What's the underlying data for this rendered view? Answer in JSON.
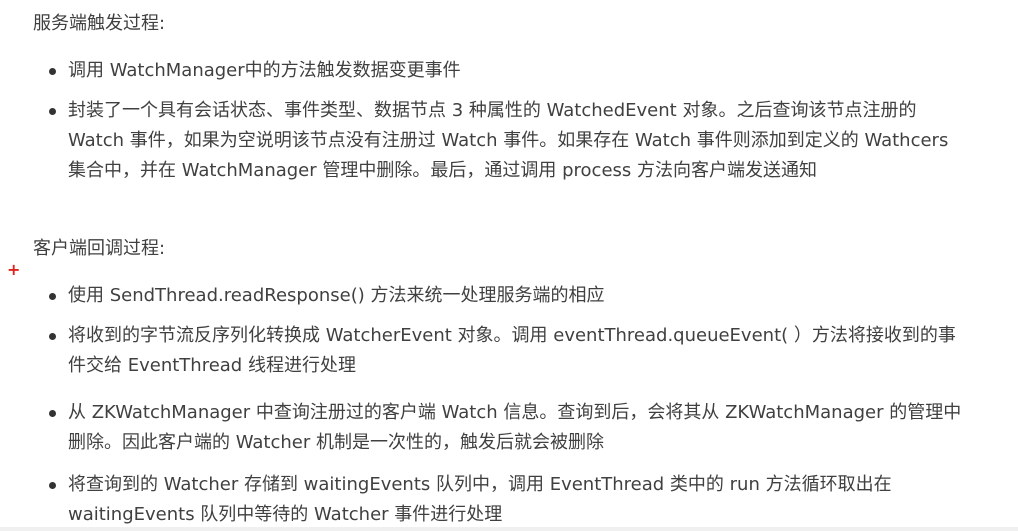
{
  "section1": {
    "heading": "服务端触发过程:",
    "items": [
      {
        "lines": [
          "调用 WatchManager中的方法触发数据变更事件"
        ]
      },
      {
        "lines": [
          "封装了一个具有会话状态、事件类型、数据节点 3 种属性的 WatchedEvent 对象。之后查询该节点注册的",
          "Watch 事件，如果为空说明该节点没有注册过 Watch 事件。如果存在 Watch 事件则添加到定义的 Wathcers",
          "集合中，并在 WatchManager 管理中删除。最后，通过调用 process 方法向客户端发送通知"
        ]
      }
    ]
  },
  "section2": {
    "heading": "客户端回调过程:",
    "items": [
      {
        "lines": [
          "使用 SendThread.readResponse() 方法来统一处理服务端的相应"
        ]
      },
      {
        "lines": [
          "将收到的字节流反序列化转换成 WatcherEvent 对象。调用 eventThread.queueEvent( ）方法将接收到的事",
          "件交给 EventThread 线程进行处理"
        ]
      },
      {
        "lines": [
          "从 ZKWatchManager 中查询注册过的客户端 Watch 信息。查询到后，会将其从 ZKWatchManager 的管理中",
          "删除。因此客户端的 Watcher 机制是一次性的，触发后就会被删除"
        ]
      },
      {
        "lines": [
          "将查询到的 Watcher 存储到 waitingEvents 队列中，调用 EventThread 类中的 run 方法循环取出在",
          "waitingEvents 队列中等待的 Watcher 事件进行处理"
        ]
      }
    ]
  },
  "colors": {
    "text": "#404040",
    "bullet": "#333333",
    "plus_marker": "#e0241b"
  },
  "plus_marker": "+"
}
